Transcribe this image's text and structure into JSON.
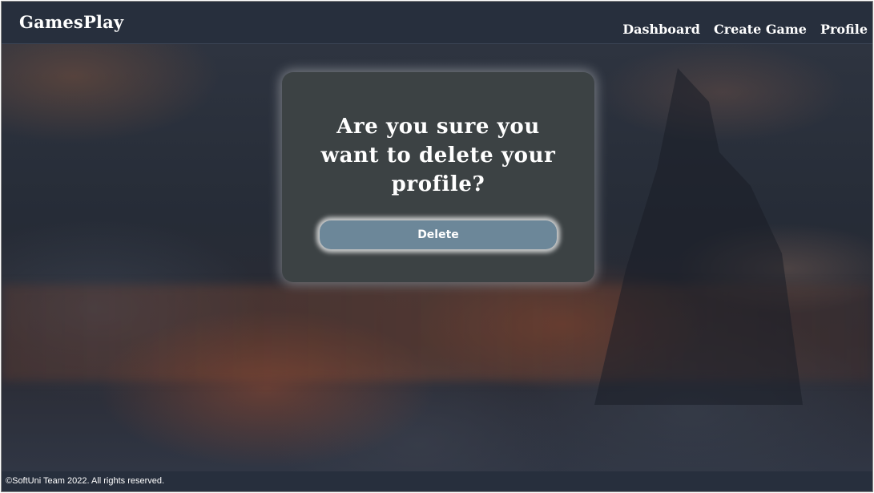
{
  "header": {
    "brand": "GamesPlay",
    "nav": {
      "dashboard": "Dashboard",
      "create_game": "Create Game",
      "profile": "Profile"
    }
  },
  "modal": {
    "question": "Are you sure you want to delete your profile?",
    "delete_label": "Delete"
  },
  "footer": {
    "copyright": "©SoftUni Team 2022. All rights reserved."
  },
  "colors": {
    "header_bg": "#272f3d",
    "card_bg": "#3c4244",
    "button_bg": "#6c8799"
  }
}
